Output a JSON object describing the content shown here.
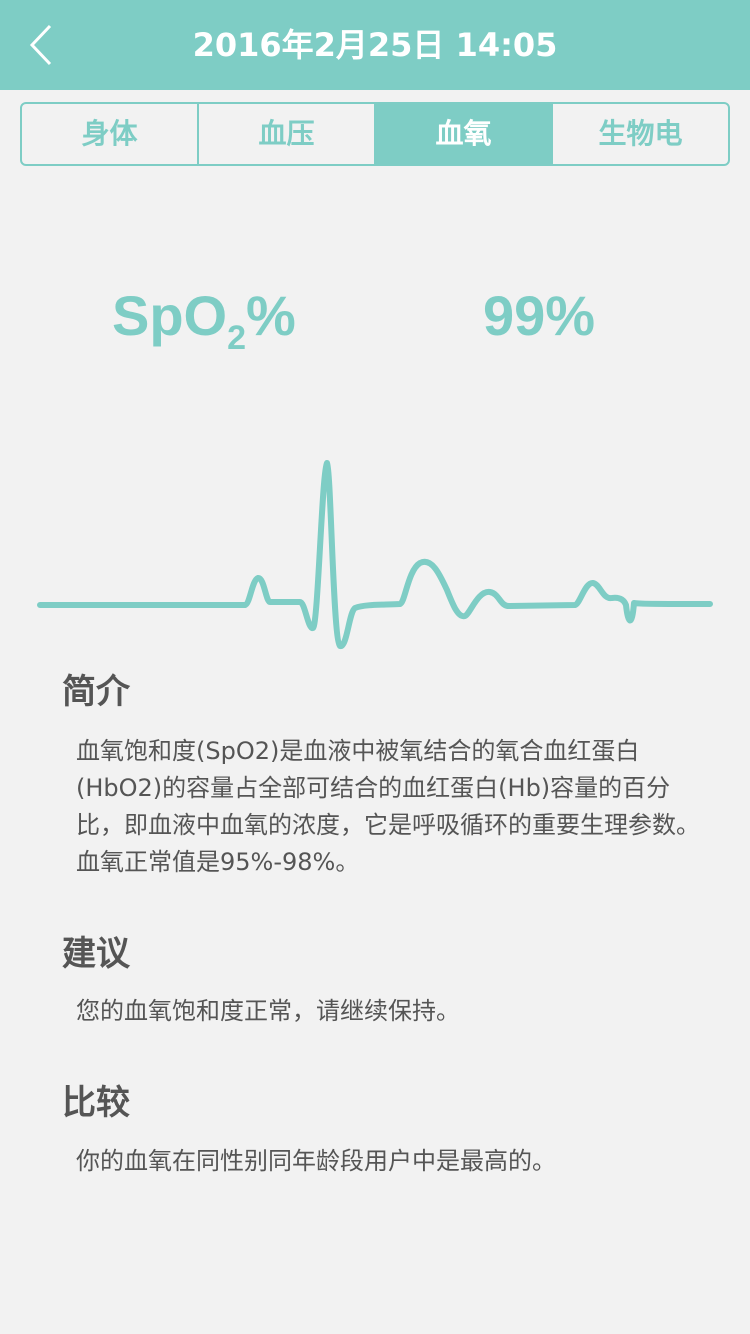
{
  "header": {
    "title": "2016年2月25日 14:05",
    "back_icon": "chevron-left-icon"
  },
  "tabs": [
    {
      "label": "身体",
      "active": false
    },
    {
      "label": "血压",
      "active": false
    },
    {
      "label": "血氧",
      "active": true
    },
    {
      "label": "生物电",
      "active": false
    }
  ],
  "metric": {
    "label_main": "SpO",
    "label_sub": "2",
    "label_suffix": "%",
    "value": "99%"
  },
  "colors": {
    "accent": "#7ecdc5",
    "text": "#555555",
    "background": "#f2f2f2"
  },
  "sections": {
    "intro": {
      "title": "简介",
      "text": "血氧饱和度(SpO2)是血液中被氧结合的氧合血红蛋白(HbO2)的容量占全部可结合的血红蛋白(Hb)容量的百分比，即血液中血氧的浓度，它是呼吸循环的重要生理参数。血氧正常值是95%-98%。"
    },
    "advice": {
      "title": "建议",
      "text": "您的血氧饱和度正常，请继续保持。"
    },
    "compare": {
      "title": "比较",
      "text": "你的血氧在同性别同年龄段用户中是最高的。"
    }
  }
}
